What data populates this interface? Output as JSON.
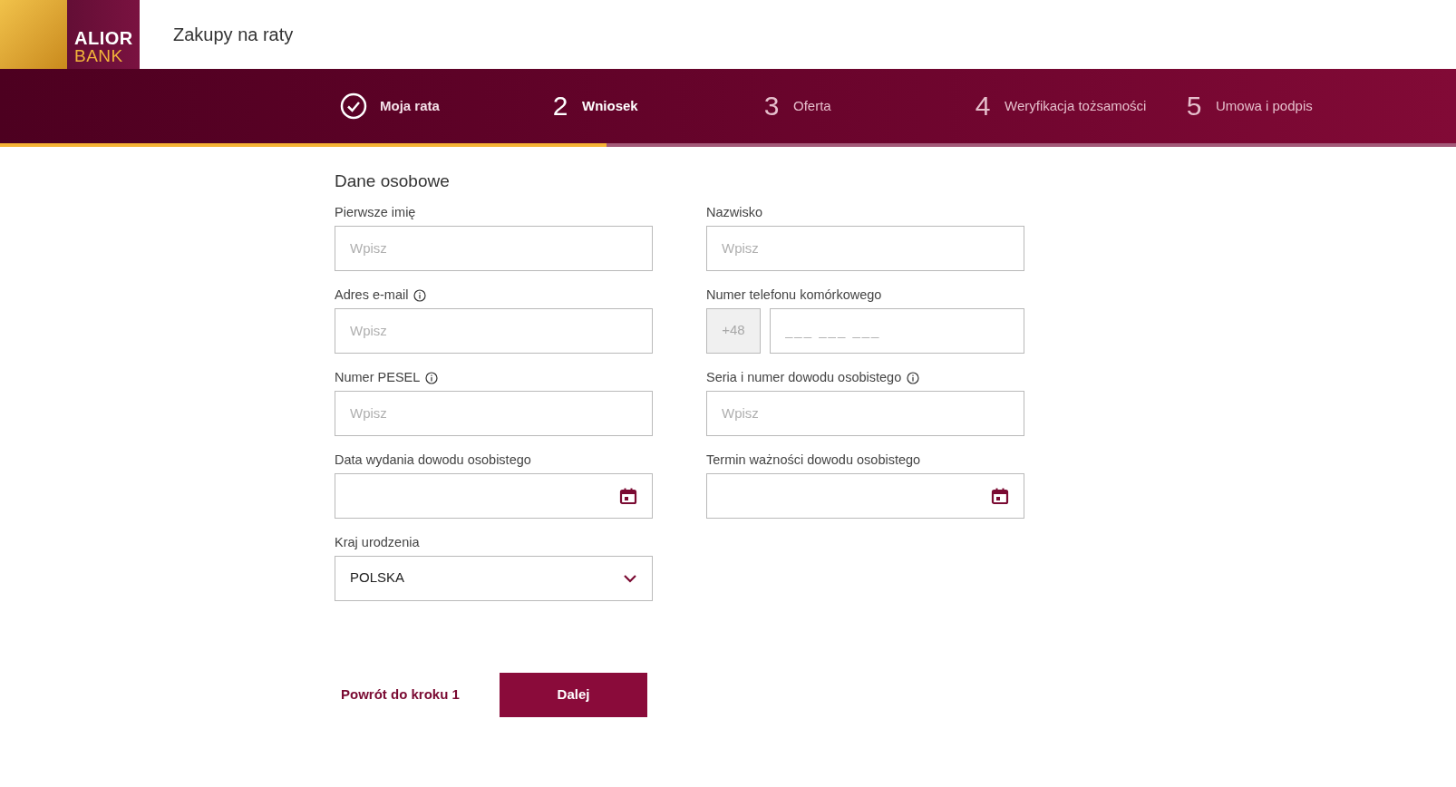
{
  "header": {
    "logo": {
      "line1": "ALIOR",
      "line2": "BANK"
    },
    "title": "Zakupy na raty"
  },
  "steps": [
    {
      "label": "Moja rata",
      "completed": true,
      "selected": false
    },
    {
      "marker": "2",
      "label": "Wniosek",
      "completed": false,
      "selected": true
    },
    {
      "marker": "3",
      "label": "Oferta",
      "completed": false,
      "selected": false
    },
    {
      "marker": "4",
      "label": "Weryfikacja tożsamości",
      "completed": false,
      "selected": false
    },
    {
      "marker": "5",
      "label": "Umowa i podpis",
      "completed": false,
      "selected": false
    }
  ],
  "progress": {
    "level": 0.4165
  },
  "section_title": "Dane osobowe",
  "fields": [
    {
      "kind": "text",
      "label": "Pierwsze imię",
      "info": false,
      "placeholder": "Wpisz"
    },
    {
      "kind": "text",
      "label": "Nazwisko",
      "info": false,
      "placeholder": "Wpisz"
    },
    {
      "kind": "text",
      "label": "Adres e-mail",
      "info": true,
      "placeholder": "Wpisz"
    },
    {
      "kind": "phone",
      "label": "Numer telefonu komórkowego",
      "info": false,
      "prefix": "+48",
      "placeholder": "___ ___ ___"
    },
    {
      "kind": "text",
      "label": "Numer PESEL",
      "info": true,
      "placeholder": "Wpisz"
    },
    {
      "kind": "text",
      "label": "Seria i numer dowodu osobistego",
      "info": true,
      "placeholder": "Wpisz"
    },
    {
      "kind": "date",
      "label": "Data wydania dowodu osobistego",
      "info": false
    },
    {
      "kind": "date",
      "label": "Termin ważności dowodu osobistego",
      "info": false
    },
    {
      "kind": "select",
      "label": "Kraj urodzenia",
      "info": false,
      "value": "POLSKA"
    }
  ],
  "actions": {
    "back": "Powrót do kroku 1",
    "next": "Dalej"
  }
}
